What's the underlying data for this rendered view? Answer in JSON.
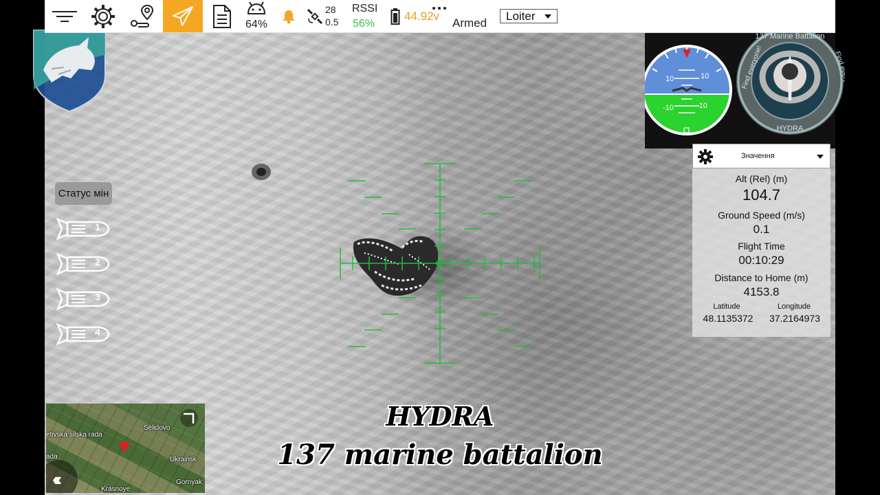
{
  "topbar": {
    "menu_icon": "menu-icon",
    "settings_icon": "gear-icon",
    "route_icon": "route-icon",
    "plan_icon": "paper-plane-icon",
    "doc_icon": "document-icon",
    "vehicle_battery_pct": "64%",
    "alert_icon": "bell-icon",
    "sat_count": "28",
    "hdop": "0.5",
    "rssi_label": "RSSI",
    "rssi_value": "56%",
    "voltage": "44.92v",
    "armed_status": "Armed",
    "flight_mode": "Loiter",
    "accent_color": "#f5a623"
  },
  "left_panel": {
    "mine_status_label": "Статус мін",
    "mines": [
      {
        "number": "1"
      },
      {
        "number": "2"
      },
      {
        "number": "3"
      },
      {
        "number": "4"
      }
    ]
  },
  "attitude": {
    "pitch_ticks": [
      "10",
      "10",
      "-10",
      "-10"
    ]
  },
  "emblem": {
    "top_text": "137 Marine Battalion",
    "left_text": "Find everyone!",
    "right_text": "Find everywhere!",
    "bottom_text": "HYDRA"
  },
  "values_panel": {
    "dropdown_label": "Значення",
    "alt_label": "Alt (Rel) (m)",
    "alt_value": "104.7",
    "ground_speed_label": "Ground Speed (m/s)",
    "ground_speed_value": "0.1",
    "flight_time_label": "Flight Time",
    "flight_time_value": "00:10:29",
    "dist_home_label": "Distance to Home (m)",
    "dist_home_value": "4153.8",
    "lat_label": "Latitude",
    "lat_value": "48.1135372",
    "lon_label": "Longitude",
    "lon_value": "37.2164973"
  },
  "minimap": {
    "labels": [
      "etivska silska rada",
      "Selidovo",
      "ada",
      "Ukrainsk",
      "Gornyak",
      "Krasnoye"
    ]
  },
  "overlay": {
    "line1": "HYDRA",
    "line2": "137 marine battalion"
  }
}
